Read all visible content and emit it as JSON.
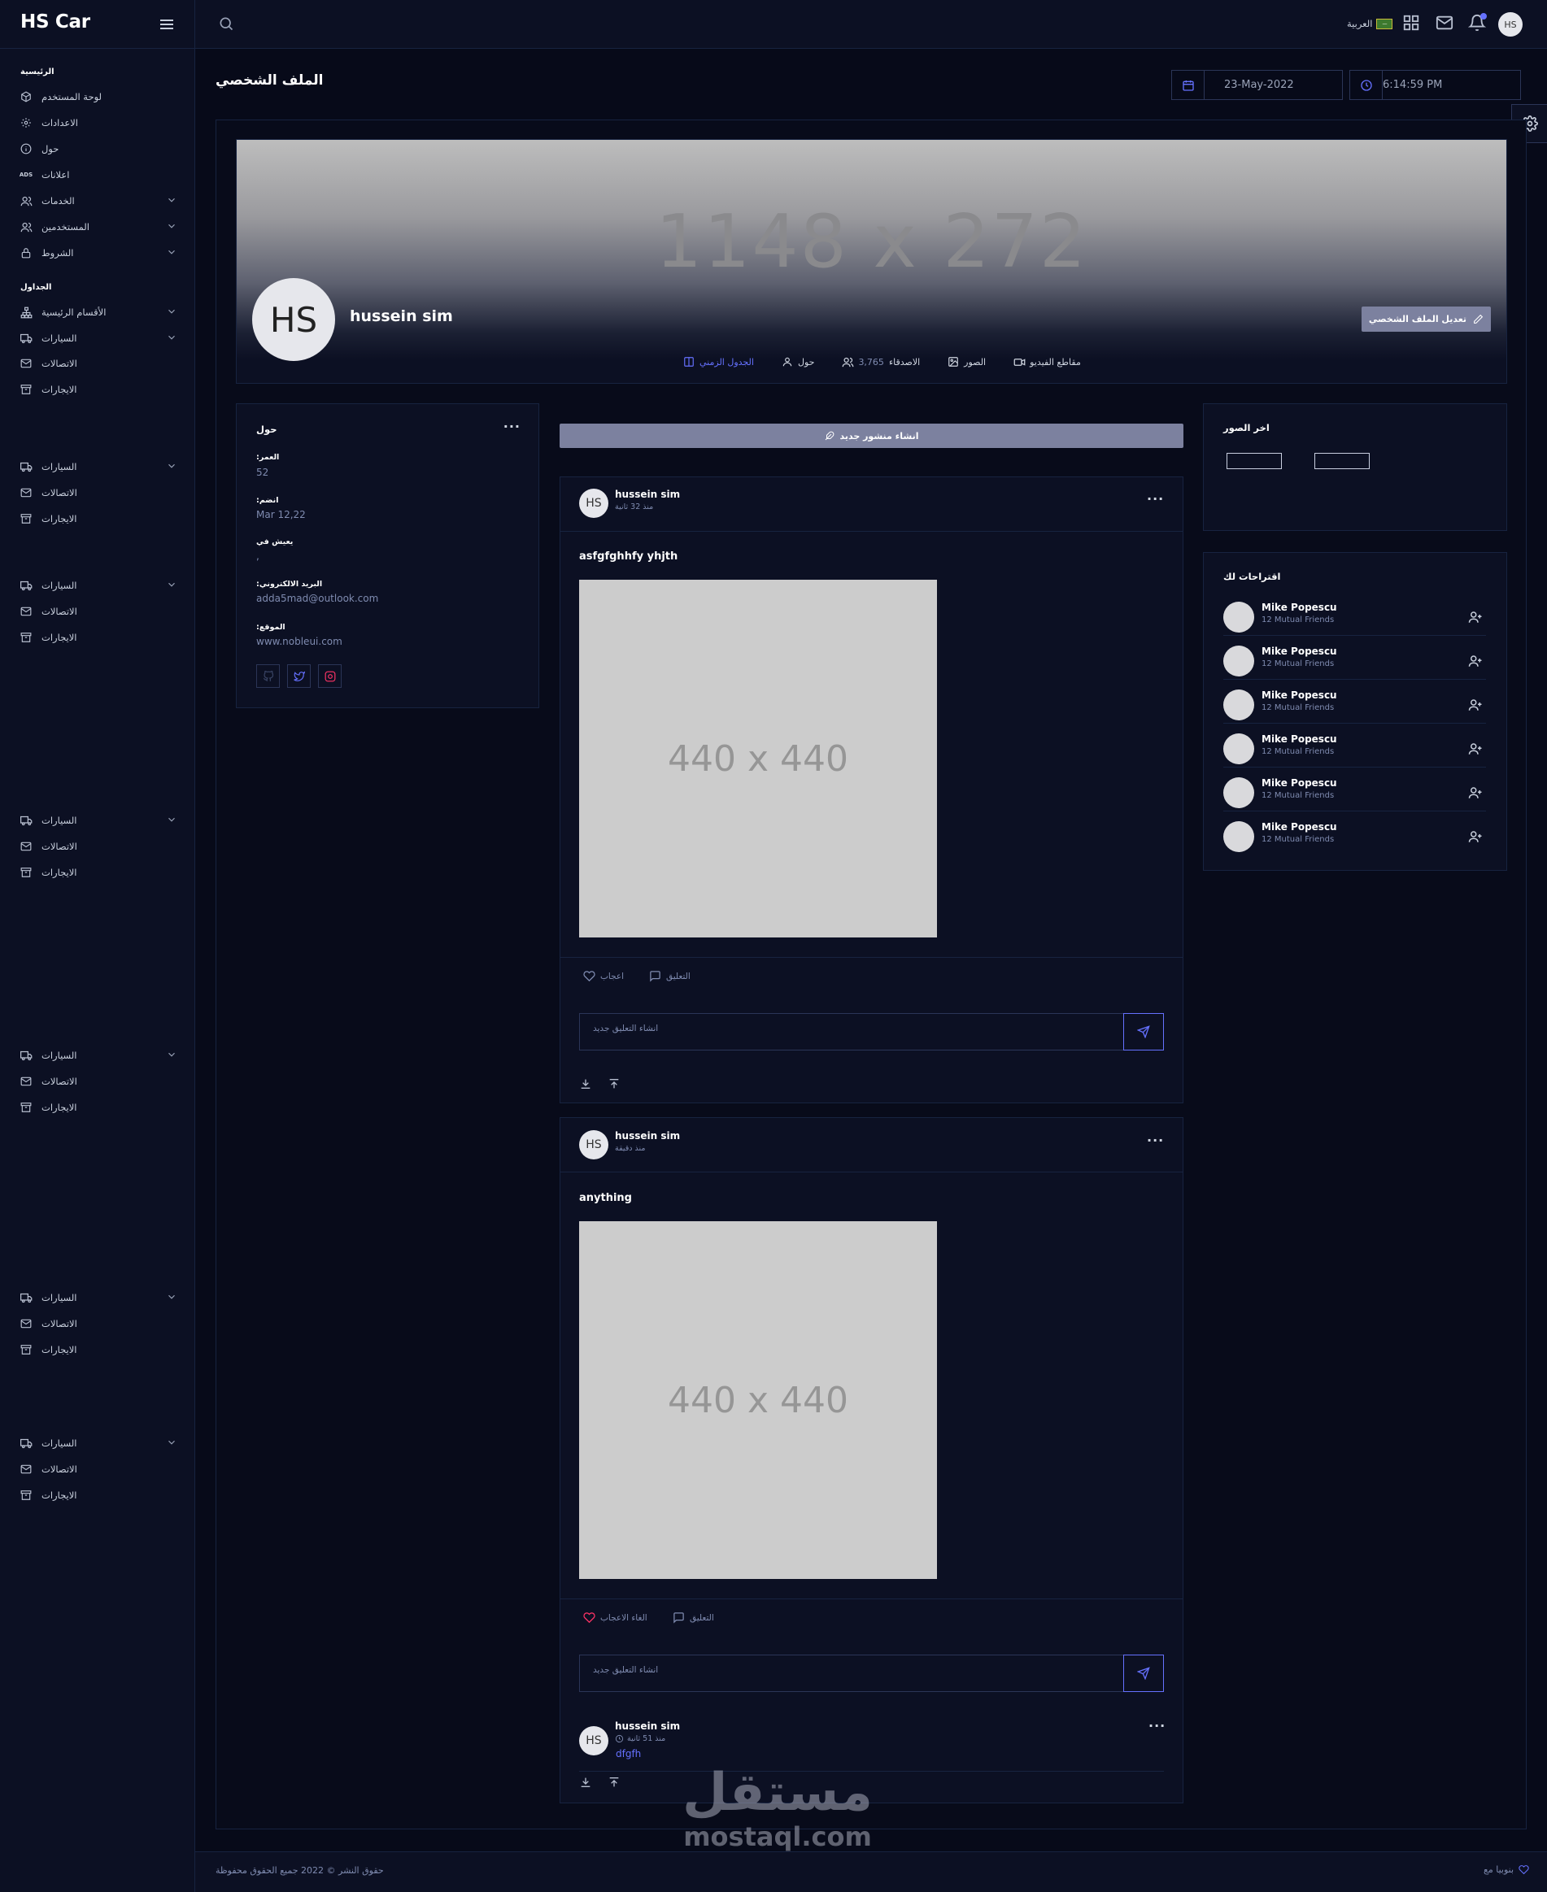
{
  "app": {
    "brand": "HS Car",
    "language": "العربية",
    "flag_text": "—",
    "user_initials": "HS"
  },
  "sidebar": {
    "cat_main": "الرئيسية",
    "cat_tables": "الجداول",
    "main_items": [
      {
        "label": "لوحة المستخدم",
        "icon": "cube-icon"
      },
      {
        "label": "الاعدادات",
        "icon": "gear-icon"
      },
      {
        "label": "حول",
        "icon": "info-icon"
      },
      {
        "label": "اعلانات",
        "icon": "ads-icon",
        "icon_text": "ADS"
      },
      {
        "label": "الخدمات",
        "icon": "users-icon",
        "chevron": true
      },
      {
        "label": "المستخدمين",
        "icon": "users-icon",
        "chevron": true
      },
      {
        "label": "الشروط",
        "icon": "lock-icon",
        "chevron": true
      }
    ],
    "tables_items": [
      {
        "label": "الأقسام الرئيسية",
        "icon": "sitemap-icon",
        "chevron": true
      },
      {
        "label": "السيارات",
        "icon": "truck-icon",
        "chevron": true
      },
      {
        "label": "الاتصالات",
        "icon": "mail-icon"
      },
      {
        "label": "الايجارات",
        "icon": "archive-icon"
      }
    ],
    "group_labels": {
      "cars": "السيارات",
      "contacts": "الاتصالات",
      "rents": "الايجارات"
    }
  },
  "header": {
    "title": "الملف الشخصي",
    "date": "23-May-2022",
    "time": "6:14:59 PM"
  },
  "profile": {
    "cover_placeholder": "1148 x 272",
    "avatar": "HS",
    "name": "hussein sim",
    "edit_label": "تعديل الملف الشخصي",
    "tabs": [
      {
        "label": "الجدول الزمني",
        "icon": "columns-icon",
        "active": true
      },
      {
        "label": "حول",
        "icon": "user-icon"
      },
      {
        "label": "الاصدقاء",
        "count": "3,765",
        "icon": "users-icon"
      },
      {
        "label": "الصور",
        "icon": "image-icon"
      },
      {
        "label": "مقاطع الفيديو",
        "icon": "video-icon"
      }
    ]
  },
  "about": {
    "title": "حول",
    "fields": [
      {
        "label": ":العمر",
        "value": "52"
      },
      {
        "label": ":انضم",
        "value": "Mar 12,22"
      },
      {
        "label": "يعيش في",
        "value": ","
      },
      {
        "label": ":البريد الالكتروني",
        "value": "adda5mad@outlook.com"
      },
      {
        "label": ":الموقع",
        "value": "www.nobleui.com"
      }
    ],
    "socials": [
      "github-icon",
      "twitter-icon",
      "instagram-icon"
    ]
  },
  "feed": {
    "new_post_label": "انشاء منشور جديد",
    "posts": [
      {
        "author": "hussein sim",
        "avatar": "HS",
        "time": "منذ 32 ثانية",
        "text": "asfgfghhfy yhjth",
        "image": "440 x 440",
        "like_label": "اعجاب",
        "comment_label": "التعليق",
        "comment_placeholder": "انشاء التعليق جديد"
      },
      {
        "author": "hussein sim",
        "avatar": "HS",
        "time": "منذ دقيقة",
        "text": "anything",
        "image": "440 x 440",
        "like_label": "الغاء الاعجاب",
        "comment_label": "التعليق",
        "comment_placeholder": "انشاء التعليق جديد",
        "comment": {
          "author": "hussein sim",
          "avatar": "HS",
          "time": "منذ 51 ثانية",
          "text": "dfgfh"
        }
      }
    ]
  },
  "photos": {
    "title": "اخر الصور"
  },
  "suggestions": {
    "title": "اقتراحات لك",
    "items": [
      {
        "name": "Mike Popescu",
        "sub": "12 Mutual Friends"
      },
      {
        "name": "Mike Popescu",
        "sub": "12 Mutual Friends"
      },
      {
        "name": "Mike Popescu",
        "sub": "12 Mutual Friends"
      },
      {
        "name": "Mike Popescu",
        "sub": "12 Mutual Friends"
      },
      {
        "name": "Mike Popescu",
        "sub": "12 Mutual Friends"
      },
      {
        "name": "Mike Popescu",
        "sub": "12 Mutual Friends"
      }
    ]
  },
  "footer": {
    "copyright": "حقوق النشر © 2022 جميع الحقوق محفوظة",
    "credit": "بنوبيا مع"
  },
  "watermark": {
    "ar": "مستقل",
    "en": "mostaql.com"
  },
  "colors": {
    "accent": "#6571ff",
    "bg": "#070a19",
    "card": "#0c1023",
    "border": "#172340"
  }
}
